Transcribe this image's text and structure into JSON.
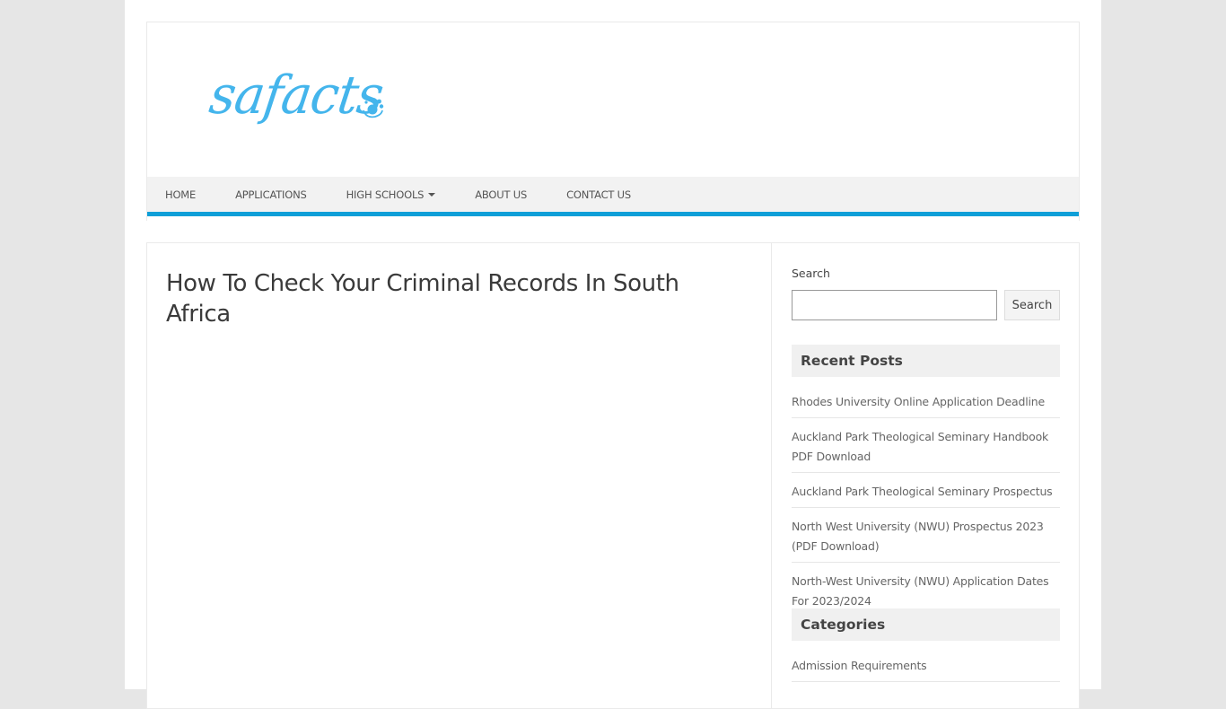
{
  "site": {
    "logo_text": "safacts",
    "brand_color": "#44b5ec",
    "accent_color": "#0d9fd8"
  },
  "nav": {
    "items": [
      {
        "label": "Home",
        "has_dropdown": false
      },
      {
        "label": "Applications",
        "has_dropdown": false
      },
      {
        "label": "High Schools",
        "has_dropdown": true
      },
      {
        "label": "About Us",
        "has_dropdown": false
      },
      {
        "label": "Contact Us",
        "has_dropdown": false
      }
    ]
  },
  "post": {
    "title": "How To Check Your Criminal Records In South Africa"
  },
  "sidebar": {
    "search": {
      "label": "Search",
      "input_value": "",
      "button_label": "Search"
    },
    "recent_posts": {
      "title": "Recent Posts",
      "items": [
        "Rhodes University Online Application Deadline",
        "Auckland Park Theological Seminary Handbook PDF Download",
        "Auckland Park Theological Seminary Prospectus",
        "North West University (NWU) Prospectus 2023 (PDF Download)",
        "North-West University (NWU) Application Dates For 2023/2024"
      ]
    },
    "categories": {
      "title": "Categories",
      "items": [
        "Admission Requirements"
      ]
    }
  }
}
